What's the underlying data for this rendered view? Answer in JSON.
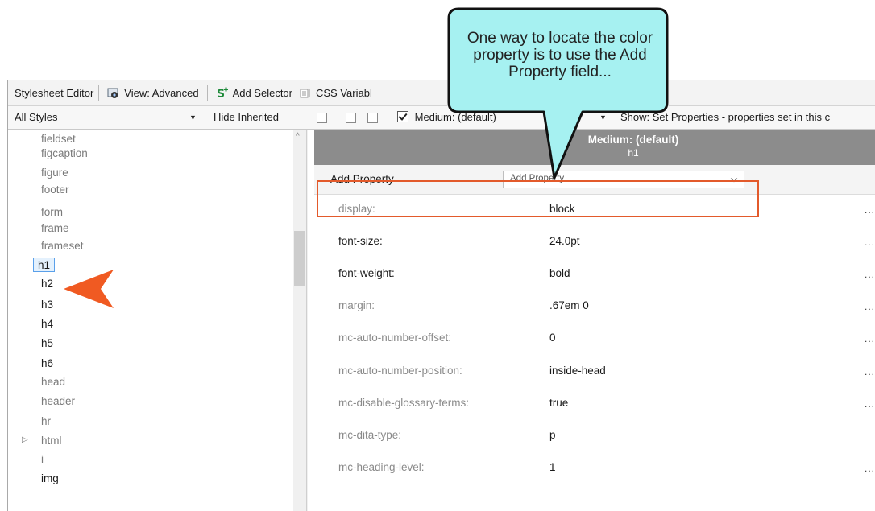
{
  "toolbar": {
    "title": "Stylesheet Editor",
    "view_label": "View: Advanced",
    "add_selector_label": "Add Selector",
    "css_variables_label": "CSS Variabl"
  },
  "filterbar": {
    "styles_select": "All Styles",
    "hide_inherited_label": "Hide Inherited",
    "medium_label": "Medium: (default)",
    "show_label": "Show: Set Properties - properties set in this c"
  },
  "tree": {
    "items": [
      {
        "label": "fieldset",
        "dim": true
      },
      {
        "label": "figcaption",
        "dim": true
      },
      {
        "label": "figure",
        "dim": true
      },
      {
        "label": "footer",
        "dim": true
      },
      {
        "label": "form",
        "dim": true
      },
      {
        "label": "frame",
        "dim": true
      },
      {
        "label": "frameset",
        "dim": true
      },
      {
        "label": "h1",
        "dim": false,
        "selected": true
      },
      {
        "label": "h2",
        "dim": false
      },
      {
        "label": "h3",
        "dim": false
      },
      {
        "label": "h4",
        "dim": false
      },
      {
        "label": "h5",
        "dim": false
      },
      {
        "label": "h6",
        "dim": false
      },
      {
        "label": "head",
        "dim": true
      },
      {
        "label": "header",
        "dim": true
      },
      {
        "label": "hr",
        "dim": true
      },
      {
        "label": "html",
        "dim": true,
        "expandable": true
      },
      {
        "label": "i",
        "dim": true
      },
      {
        "label": "img",
        "dim": false
      }
    ]
  },
  "grid": {
    "medium_header": "Medium: (default)",
    "selector_header": "h1",
    "add_property_label": "Add Property",
    "add_property_placeholder": "Add Property",
    "properties": [
      {
        "name": "display:",
        "value": "block",
        "dim": true,
        "more": true
      },
      {
        "name": "font-size:",
        "value": "24.0pt",
        "dim": false,
        "more": true
      },
      {
        "name": "font-weight:",
        "value": "bold",
        "dim": false,
        "more": true
      },
      {
        "name": "margin:",
        "value": ".67em 0",
        "dim": true,
        "more": true
      },
      {
        "name": "mc-auto-number-offset:",
        "value": "0",
        "dim": true,
        "more": true
      },
      {
        "name": "mc-auto-number-position:",
        "value": "inside-head",
        "dim": true,
        "more": true
      },
      {
        "name": "mc-disable-glossary-terms:",
        "value": "true",
        "dim": true,
        "more": true
      },
      {
        "name": "mc-dita-type:",
        "value": "p",
        "dim": true,
        "more": false
      },
      {
        "name": "mc-heading-level:",
        "value": "1",
        "dim": true,
        "more": true
      }
    ],
    "more_label": "..."
  },
  "callout": {
    "text": "One way to locate the color property is to use the Add Property field..."
  },
  "colors": {
    "callout_fill": "#a6f1f1",
    "highlight": "#e35a2b",
    "header_bg": "#8c8c8c",
    "selection": "#5aa0ea"
  },
  "icons": [
    "eye-view-icon",
    "add-selector-icon",
    "css-variables-icon",
    "compare-icon",
    "copy-icon",
    "add-icon",
    "dropdown-arrow-icon"
  ]
}
